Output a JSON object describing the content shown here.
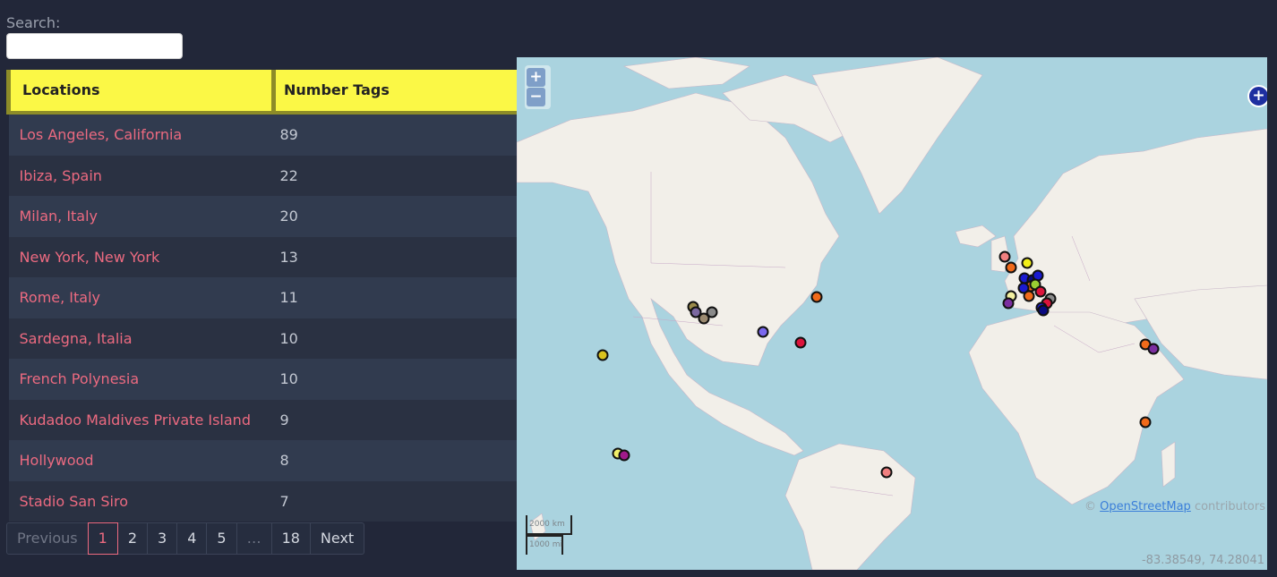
{
  "search": {
    "label": "Search:",
    "value": "",
    "placeholder": ""
  },
  "table": {
    "headers": [
      "Locations",
      "Number Tags"
    ],
    "rows": [
      {
        "location": "Los Angeles, California",
        "count": "89"
      },
      {
        "location": "Ibiza, Spain",
        "count": "22"
      },
      {
        "location": "Milan, Italy",
        "count": "20"
      },
      {
        "location": "New York, New York",
        "count": "13"
      },
      {
        "location": "Rome, Italy",
        "count": "11"
      },
      {
        "location": "Sardegna, Italia",
        "count": "10"
      },
      {
        "location": "French Polynesia",
        "count": "10"
      },
      {
        "location": "Kudadoo Maldives Private Island",
        "count": "9"
      },
      {
        "location": "Hollywood",
        "count": "8"
      },
      {
        "location": "Stadio San Siro",
        "count": "7"
      }
    ]
  },
  "pagination": {
    "previous": "Previous",
    "pages": [
      "1",
      "2",
      "3",
      "4",
      "5",
      "…",
      "18"
    ],
    "active": "1",
    "next": "Next"
  },
  "map": {
    "zoom_in": "+",
    "zoom_out": "−",
    "layers": "+",
    "attribution_prefix": "© ",
    "attribution_link": "OpenStreetMap",
    "attribution_suffix": " contributors",
    "scale_top": "2000 km",
    "scale_bottom": "1000 mi",
    "coordinates": "-83.38549, 74.28041"
  },
  "colors": {
    "accent": "#ec6a80",
    "header": "#fbf846",
    "water": "#aad3df",
    "land": "#f2efe9"
  }
}
